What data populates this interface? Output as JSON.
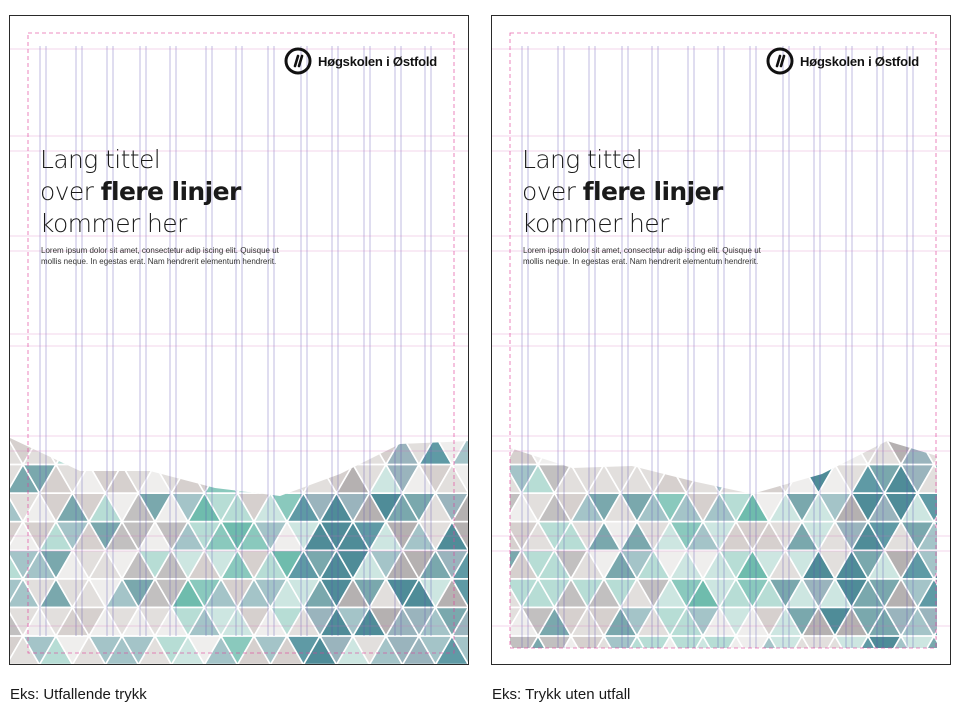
{
  "posters": [
    {
      "id": "bleed",
      "logo_text": "Høgskolen i Østfold",
      "title": {
        "line1": "Lang tittel",
        "line2_prefix": "over ",
        "line2_bold": "flere linjer",
        "line3": "kommer her"
      },
      "body": "Lorem ipsum dolor sit amet, consectetur adip iscing elit. Quisque ut mollis neque. In egestas erat. Nam hendrerit elementum hendrerit.",
      "caption": "Eks: Utfallende trykk"
    },
    {
      "id": "no-bleed",
      "logo_text": "Høgskolen i Østfold",
      "title": {
        "line1": "Lang tittel",
        "line2_prefix": "over ",
        "line2_bold": "flere linjer",
        "line3": "kommer her"
      },
      "body": "Lorem ipsum dolor sit amet, consectetur adip iscing elit. Quisque ut mollis neque. In egestas erat. Nam hendrerit elementum hendrerit.",
      "caption": "Eks: Trykk uten utfall"
    }
  ],
  "colors": {
    "grid_column": "#5a4fb0",
    "grid_row": "#d46ab8",
    "margin_guide": "#e0409a",
    "hex_palette": [
      "#e2dfdd",
      "#d6d0ce",
      "#efeeed",
      "#c2c0c0",
      "#a4c4c8",
      "#7aa8ad",
      "#5f9aa5",
      "#4f8c98",
      "#8ac9bd",
      "#6fbcad",
      "#b7ddd5",
      "#cde6e1",
      "#9ab4bd",
      "#b5b1b1"
    ]
  }
}
